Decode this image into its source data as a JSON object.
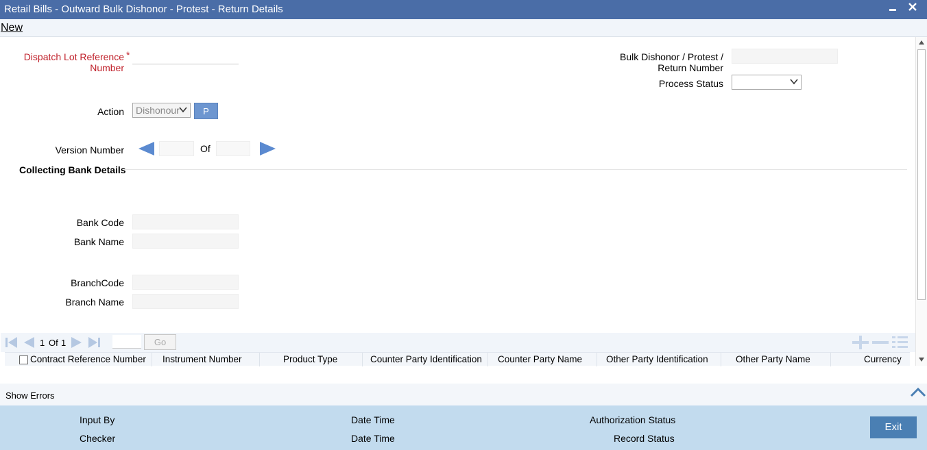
{
  "window": {
    "title": "Retail Bills - Outward Bulk Dishonor - Protest - Return Details",
    "minimize_icon": "minimize-icon",
    "close_icon": "close-icon"
  },
  "menu": {
    "new_label": "New"
  },
  "form": {
    "dispatch_lot_label": "Dispatch Lot Reference Number",
    "dispatch_lot_value": "",
    "bulk_number_label": "Bulk Dishonor / Protest / Return Number",
    "bulk_number_value": "",
    "process_status_label": "Process Status",
    "process_status_value": "",
    "action_label": "Action",
    "action_value": "Dishonour",
    "p_button_label": "P",
    "version_label": "Version Number",
    "version_value": "",
    "version_of_label": "Of",
    "version_total": ""
  },
  "collecting_bank": {
    "section_title": "Collecting Bank Details",
    "bank_code_label": "Bank Code",
    "bank_name_label": "Bank Name",
    "branch_code_label": "BranchCode",
    "branch_name_label": "Branch Name"
  },
  "grid": {
    "page_current": "1",
    "page_of": "Of",
    "page_total": "1",
    "go_label": "Go",
    "columns": [
      "Contract Reference Number",
      "Instrument Number",
      "Product Type",
      "Counter Party Identification",
      "Counter Party Name",
      "Other Party Identification",
      "Other Party Name",
      "Currency"
    ]
  },
  "errors": {
    "label": "Show Errors"
  },
  "footer": {
    "input_by": "Input By",
    "checker": "Checker",
    "date_time_1": "Date Time",
    "date_time_2": "Date Time",
    "authorization_status": "Authorization Status",
    "record_status": "Record Status",
    "exit_label": "Exit"
  },
  "colors": {
    "title_bar": "#4a6da7",
    "accent_button": "#6d96d0",
    "footer_bg": "#c2dbee",
    "exit_button": "#4a7fb3",
    "required_label": "#c0202a"
  }
}
